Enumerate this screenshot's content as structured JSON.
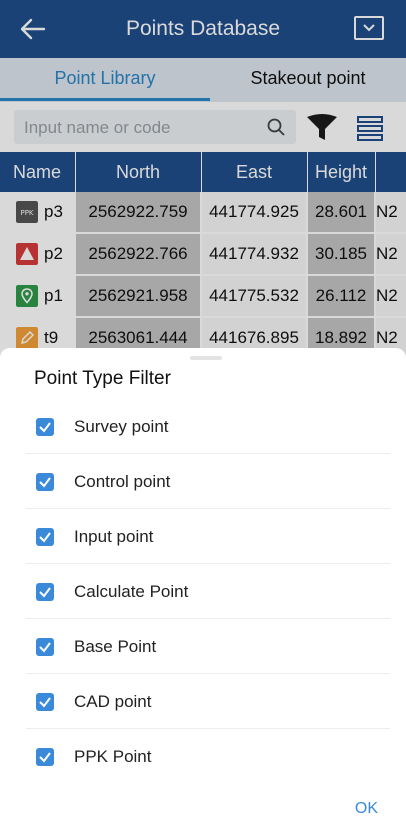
{
  "header": {
    "title": "Points Database",
    "back_icon": "arrow-left-icon",
    "menu_icon": "chevron-down-icon"
  },
  "tabs": [
    {
      "label": "Point Library",
      "active": true
    },
    {
      "label": "Stakeout point",
      "active": false
    }
  ],
  "search": {
    "placeholder": "Input name or code",
    "value": ""
  },
  "table": {
    "columns": [
      "Name",
      "North",
      "East",
      "Height"
    ],
    "rows": [
      {
        "icon": "ppk-icon",
        "icon_color": "#555555",
        "name": "p3",
        "north": "2562922.759",
        "east": "441774.925",
        "height": "28.601",
        "code": "N2"
      },
      {
        "icon": "control-triangle-icon",
        "icon_color": "#d83b3b",
        "name": "p2",
        "north": "2562922.766",
        "east": "441774.932",
        "height": "30.185",
        "code": "N2"
      },
      {
        "icon": "location-pin-icon",
        "icon_color": "#2f9a4a",
        "name": "p1",
        "north": "2562921.958",
        "east": "441775.532",
        "height": "26.112",
        "code": "N2"
      },
      {
        "icon": "edit-icon",
        "icon_color": "#f2a23a",
        "name": "t9",
        "north": "2563061.444",
        "east": "441676.895",
        "height": "18.892",
        "code": "N2"
      }
    ]
  },
  "filter_sheet": {
    "title": "Point Type Filter",
    "options": [
      {
        "label": "Survey point",
        "checked": true
      },
      {
        "label": "Control point",
        "checked": true
      },
      {
        "label": "Input point",
        "checked": true
      },
      {
        "label": "Calculate Point",
        "checked": true
      },
      {
        "label": "Base Point",
        "checked": true
      },
      {
        "label": "CAD point",
        "checked": true
      },
      {
        "label": "PPK Point",
        "checked": true
      }
    ],
    "ok_label": "OK"
  },
  "colors": {
    "header_bg": "#1f4e8c",
    "accent": "#2a86c8",
    "checkbox": "#3b8ad9"
  }
}
